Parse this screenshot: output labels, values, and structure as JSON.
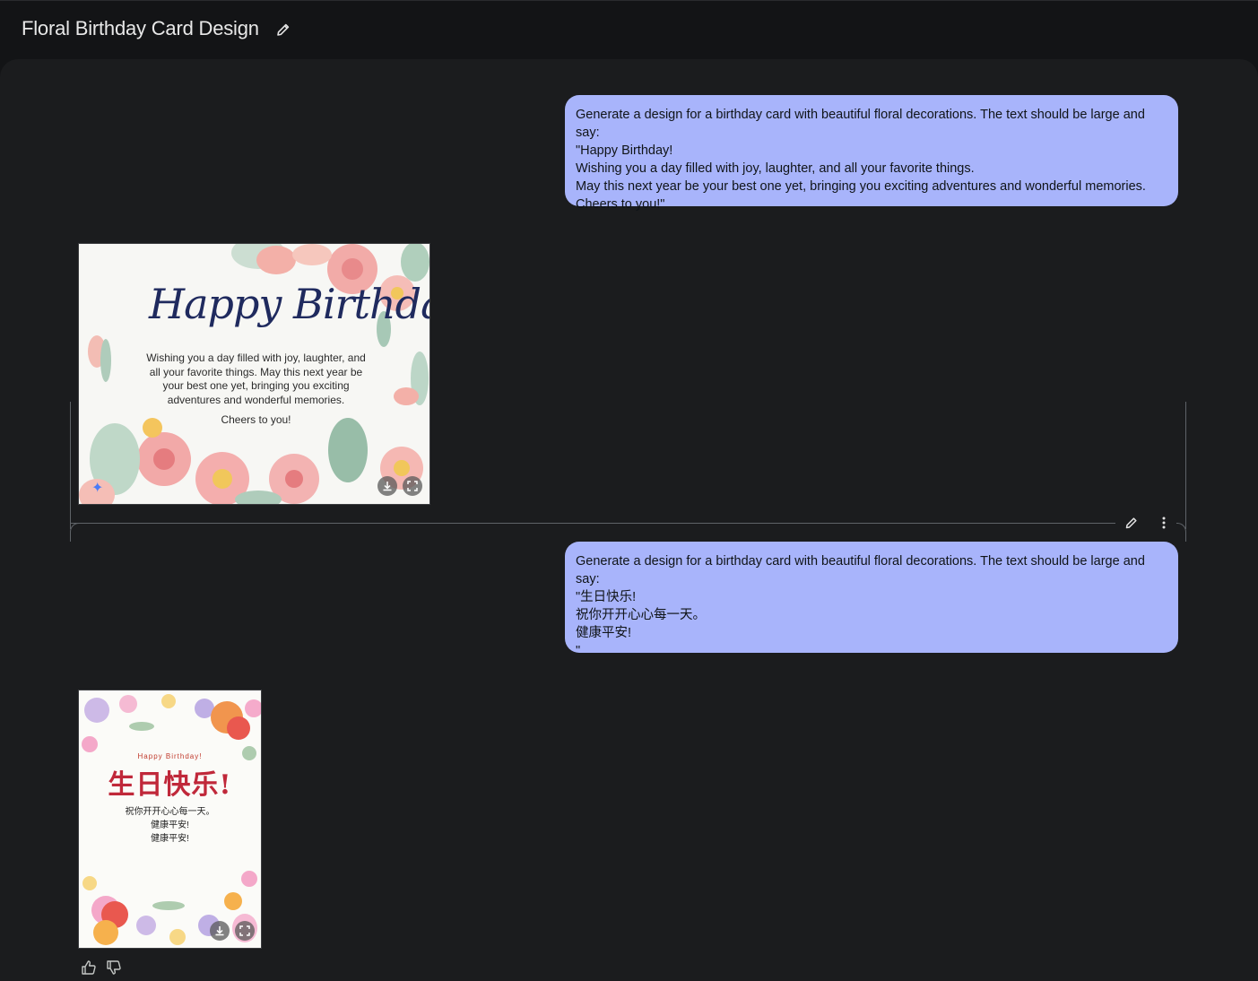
{
  "header": {
    "title": "Floral Birthday Card Design",
    "edit_icon": "pencil-icon"
  },
  "conversation": [
    {
      "role": "user",
      "lines": [
        "Generate a design for a birthday card with beautiful floral decorations. The text should be large and say:",
        "\"Happy Birthday!",
        "Wishing you a day filled with joy, laughter, and all your favorite things.",
        "May this next year be your best one yet, bringing you exciting adventures and wonderful memories.",
        "Cheers to you!\""
      ]
    },
    {
      "role": "model",
      "image": {
        "title": "Happy Birthday!",
        "body": "Wishing you a day filled with joy, laughter, and all your favorite things. May this next year be your best one yet, bringing you exciting adventures and wonderful memories.",
        "closing": "Cheers to you!"
      }
    },
    {
      "role": "user",
      "lines": [
        "Generate a design for a birthday card with beautiful floral decorations. The text should be large and say:",
        "\"生日快乐!",
        "祝你开开心心每一天。",
        "健康平安!",
        "\""
      ]
    },
    {
      "role": "model",
      "image": {
        "subtitle": "Happy Birthday!",
        "title": "生日快乐!",
        "lines": [
          "祝你开开心心每一天。",
          "健康平安!",
          "健康平安!"
        ]
      }
    }
  ],
  "icons": {
    "edit": "pencil-icon",
    "more": "more-vertical-icon",
    "download": "download-icon",
    "fullscreen": "fullscreen-icon",
    "thumbs_up": "thumbs-up-icon",
    "thumbs_down": "thumbs-down-icon",
    "sparkle": "sparkle-icon"
  },
  "colors": {
    "background": "#1b1c1e",
    "topbar": "#131416",
    "user_bubble": "#a8b4fb",
    "card1_title": "#1f2a5e",
    "card2_title": "#c0283a"
  }
}
